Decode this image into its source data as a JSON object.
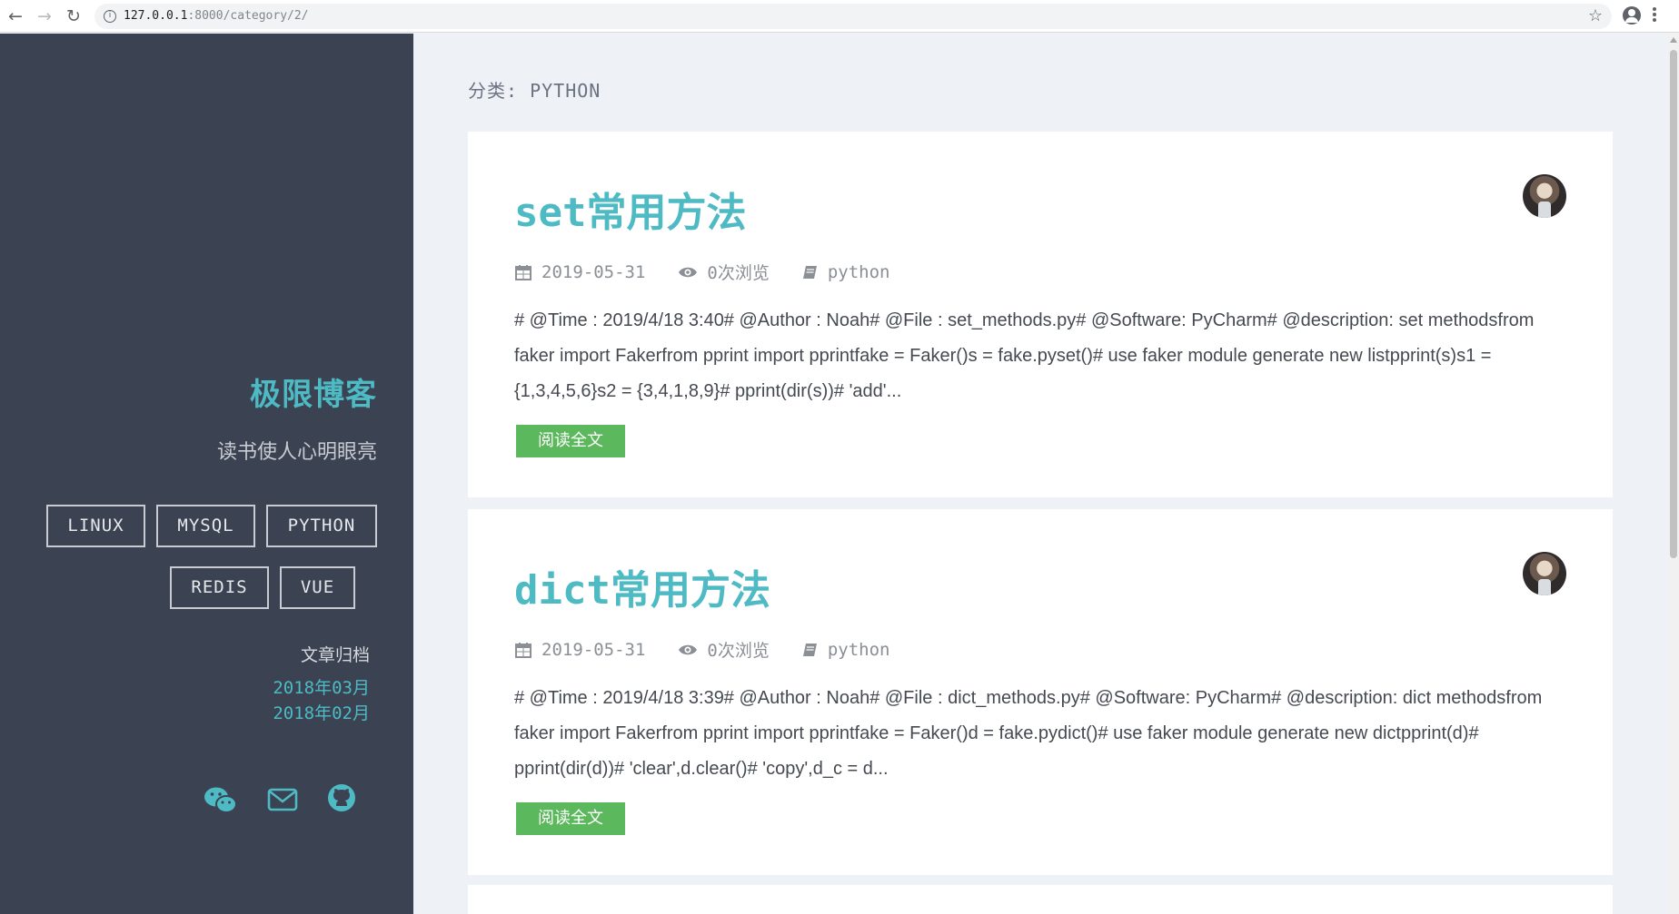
{
  "browser": {
    "url_host": "127.0.0.1",
    "url_rest": ":8000/category/2/",
    "back_icon": "back-arrow-icon",
    "forward_icon": "forward-arrow-icon",
    "reload_icon": "reload-icon"
  },
  "sidebar": {
    "title": "极限博客",
    "subtitle": "读书使人心明眼亮",
    "tags": [
      "LINUX",
      "MYSQL",
      "PYTHON",
      "REDIS",
      "VUE"
    ],
    "archive_title": "文章归档",
    "archives": [
      "2018年03月",
      "2018年02月"
    ],
    "social_icons": [
      "wechat-icon",
      "mail-icon",
      "github-icon"
    ]
  },
  "main": {
    "category_heading": "分类: PYTHON",
    "posts": [
      {
        "title": "set常用方法",
        "date": "2019-05-31",
        "views": "0次浏览",
        "category": "python",
        "excerpt": "# @Time : 2019/4/18 3:40# @Author : Noah# @File : set_methods.py# @Software: PyCharm# @description: set methodsfrom faker import Fakerfrom pprint import pprintfake = Faker()s = fake.pyset()# use faker module generate new listpprint(s)s1 = {1,3,4,5,6}s2 = {3,4,1,8,9}# pprint(dir(s))# 'add'...",
        "read_more": "阅读全文"
      },
      {
        "title": "dict常用方法",
        "date": "2019-05-31",
        "views": "0次浏览",
        "category": "python",
        "excerpt": "# @Time : 2019/4/18 3:39# @Author : Noah# @File : dict_methods.py# @Software: PyCharm# @description: dict methodsfrom faker import Fakerfrom pprint import pprintfake = Faker()d = fake.pydict()# use faker module generate new dictpprint(d)# pprint(dir(d))# 'clear',d.clear()# 'copy',d_c = d...",
        "read_more": "阅读全文"
      }
    ]
  },
  "colors": {
    "accent": "#4dbac4",
    "sidebar_bg": "#3b4252",
    "button_green": "#5cb85c",
    "page_bg": "#eef2f7"
  }
}
